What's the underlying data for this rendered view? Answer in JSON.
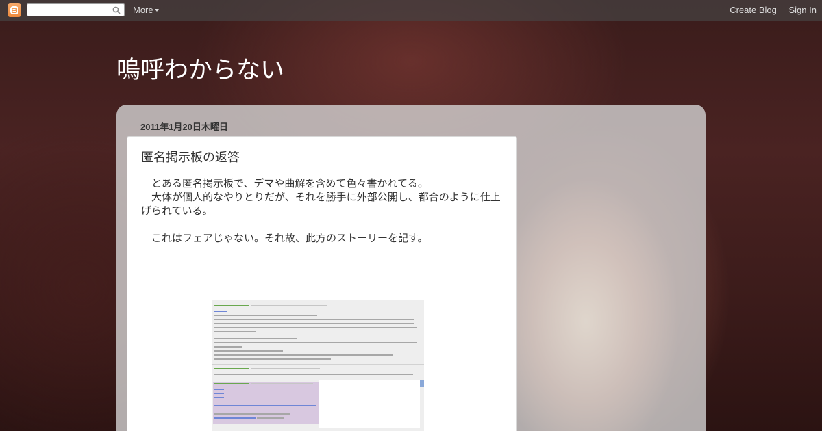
{
  "navbar": {
    "logo_icon": "blogger-icon",
    "search_placeholder": "",
    "search_icon": "search-icon",
    "more_label": "More",
    "create_blog_label": "Create Blog",
    "sign_in_label": "Sign In"
  },
  "blog": {
    "title": "嗚呼わからない"
  },
  "post": {
    "date": "2011年1月20日木曜日",
    "title": "匿名掲示板の返答",
    "paragraphs": [
      "　とある匿名掲示板で、デマや曲解を含めて色々書かれてる。",
      "　大体が個人的なやりとりだが、それを勝手に外部公開し、都合のように仕上げられている。",
      "　これはフェアじゃない。それ故、此方のストーリーを記す。"
    ]
  },
  "colors": {
    "navbar_text": "#dddddd",
    "blogger_orange": "#ef8a3c",
    "panel": "#d7d7d7",
    "text": "#333333"
  }
}
